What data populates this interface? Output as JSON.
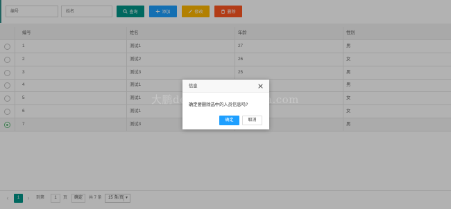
{
  "toolbar": {
    "id_placeholder": "编号",
    "name_placeholder": "姓名",
    "query_label": "查询",
    "add_label": "添加",
    "edit_label": "修改",
    "delete_label": "删除"
  },
  "table": {
    "headers": [
      "编号",
      "姓名",
      "年龄",
      "性别"
    ],
    "rows": [
      {
        "id": "1",
        "name": "测试1",
        "age": "27",
        "gender": "男",
        "selected": false
      },
      {
        "id": "2",
        "name": "测试2",
        "age": "26",
        "gender": "女",
        "selected": false
      },
      {
        "id": "3",
        "name": "测试3",
        "age": "25",
        "gender": "男",
        "selected": false
      },
      {
        "id": "4",
        "name": "测试1",
        "age": "",
        "gender": "男",
        "selected": false
      },
      {
        "id": "5",
        "name": "测试1",
        "age": "",
        "gender": "女",
        "selected": false
      },
      {
        "id": "6",
        "name": "测试1",
        "age": "",
        "gender": "女",
        "selected": false
      },
      {
        "id": "7",
        "name": "测试3",
        "age": "",
        "gender": "男",
        "selected": true
      }
    ]
  },
  "pager": {
    "prev": "‹",
    "current_page": "1",
    "next": "›",
    "goto_label": "到第",
    "page_input": "1",
    "page_unit": "页",
    "confirm_label": "确定",
    "total_label": "共 7 条",
    "page_size": "15 条/页"
  },
  "dialog": {
    "title": "信息",
    "message": "确定要删除选中的人员信息吗?",
    "ok_label": "确定",
    "cancel_label": "取消"
  },
  "watermark": "大鹏de教程@xuebaima.com",
  "colors": {
    "accent": "#009688",
    "blue": "#1e9fff",
    "yellow": "#ffb800",
    "red": "#ff5722"
  }
}
